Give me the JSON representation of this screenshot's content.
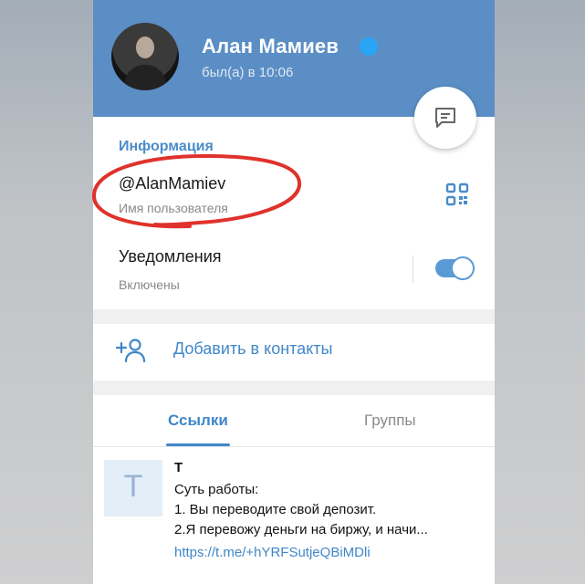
{
  "profile": {
    "name": "Алан Мамиев",
    "status": "был(а) в 10:06"
  },
  "info": {
    "section_title": "Информация",
    "username": "@AlanMamiev",
    "username_label": "Имя пользователя",
    "notifications": "Уведомления",
    "notifications_state": "Включены",
    "notifications_enabled": true
  },
  "actions": {
    "add_contact": "Добавить в контакты"
  },
  "tabs": [
    {
      "label": "Ссылки",
      "active": true
    },
    {
      "label": "Группы",
      "active": false
    }
  ],
  "link_item": {
    "thumb_letter": "T",
    "title": "T",
    "lines": [
      "Суть работы:",
      "1. Вы переводите свой депозит.",
      "2.Я перевожу деньги на биржу, и начи..."
    ],
    "url": "https://t.me/+hYRFSutjeQBiMDli"
  },
  "colors": {
    "header": "#5b8ec5",
    "accent": "#3f87c9",
    "verified": "#2aa4f4",
    "annotation": "#e0322c"
  },
  "icons": {
    "message": "message-icon",
    "qr": "qr-code-icon",
    "add_user": "add-user-icon",
    "verified": "verified-icon"
  }
}
